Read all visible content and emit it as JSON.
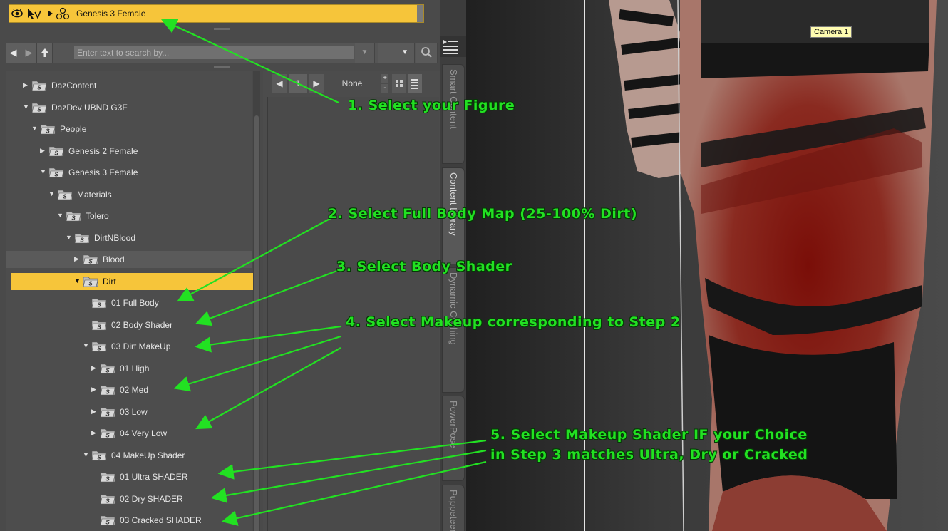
{
  "scene_bar": {
    "figure_label": "Genesis 3 Female"
  },
  "content_toolbar": {
    "search_placeholder": "Enter text to search by..."
  },
  "middle_toolbar": {
    "page": "1",
    "filter": "None"
  },
  "tree": [
    {
      "label": "DazContent",
      "expanded": false,
      "depth": 0
    },
    {
      "label": "DazDev UBND G3F",
      "expanded": true,
      "depth": 0
    },
    {
      "label": "People",
      "expanded": true,
      "depth": 1
    },
    {
      "label": "Genesis 2 Female",
      "expanded": false,
      "depth": 2
    },
    {
      "label": "Genesis 3 Female",
      "expanded": true,
      "depth": 2
    },
    {
      "label": "Materials",
      "expanded": true,
      "depth": 3
    },
    {
      "label": "Tolero",
      "expanded": true,
      "depth": 4
    },
    {
      "label": "DirtNBlood",
      "expanded": true,
      "depth": 5
    },
    {
      "label": "Blood",
      "expanded": false,
      "depth": 6
    },
    {
      "label": "Dirt",
      "expanded": true,
      "depth": 6,
      "selected": true
    },
    {
      "label": "01 Full Body",
      "leaf": true,
      "depth": 7
    },
    {
      "label": "02 Body Shader",
      "leaf": true,
      "depth": 7
    },
    {
      "label": "03 Dirt MakeUp",
      "expanded": true,
      "depth": 7
    },
    {
      "label": "01 High",
      "expanded": false,
      "depth": 8
    },
    {
      "label": "02 Med",
      "expanded": false,
      "depth": 8
    },
    {
      "label": "03 Low",
      "expanded": false,
      "depth": 8
    },
    {
      "label": "04 Very Low",
      "expanded": false,
      "depth": 8
    },
    {
      "label": "04 MakeUp Shader",
      "expanded": true,
      "depth": 7
    },
    {
      "label": "01 Ultra SHADER",
      "leaf": true,
      "depth": 8
    },
    {
      "label": "02 Dry SHADER",
      "leaf": true,
      "depth": 8
    },
    {
      "label": "03 Cracked SHADER",
      "leaf": true,
      "depth": 8
    }
  ],
  "side_tabs": [
    {
      "label": "Smart Content",
      "active": false
    },
    {
      "label": "Content Library",
      "active": true
    },
    {
      "label": "Dynamic Clothing",
      "active": false
    },
    {
      "label": "PowerPose",
      "active": false
    },
    {
      "label": "Puppeteer",
      "active": false
    }
  ],
  "viewport": {
    "camera_label": "Camera 1"
  },
  "annotations": [
    "1. Select your Figure",
    "2. Select Full Body Map (25-100% Dirt)",
    "3. Select Body Shader",
    "4. Select Makeup corresponding to Step 2",
    "5. Select Makeup Shader IF your Choice",
    "in Step 3 matches Ultra, Dry or Cracked"
  ],
  "colors": {
    "selection": "#f6c53a",
    "annotation": "#22e122",
    "panel": "#4a4a4a"
  }
}
